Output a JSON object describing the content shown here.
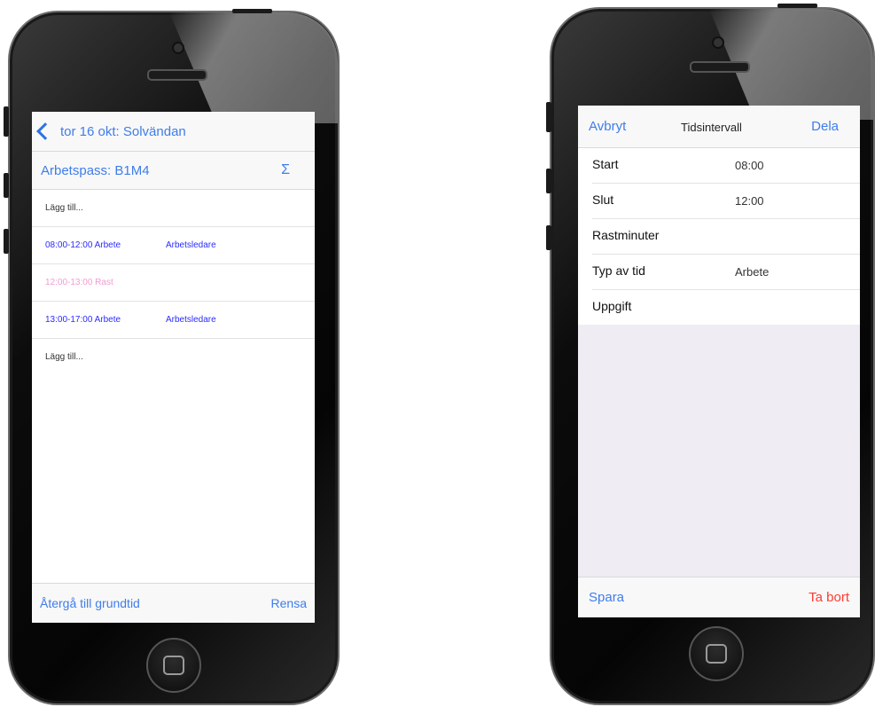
{
  "left": {
    "back_label": "tor 16 okt: Solvändan",
    "subheader_title": "Arbetspass: B1M4",
    "sum_symbol": "Σ",
    "rows": [
      {
        "time": "Lägg till...",
        "role": "",
        "kind": "add"
      },
      {
        "time": "08:00-12:00 Arbete",
        "role": "Arbetsledare",
        "kind": "work"
      },
      {
        "time": "12:00-13:00 Rast",
        "role": "",
        "kind": "break"
      },
      {
        "time": "13:00-17:00 Arbete",
        "role": "Arbetsledare",
        "kind": "work"
      },
      {
        "time": "Lägg till...",
        "role": "",
        "kind": "add"
      }
    ],
    "toolbar": {
      "revert_label": "Återgå till grundtid",
      "clear_label": "Rensa"
    }
  },
  "right": {
    "cancel_label": "Avbryt",
    "title": "Tidsintervall",
    "share_label": "Dela",
    "fields": [
      {
        "label": "Start",
        "value": "08:00"
      },
      {
        "label": "Slut",
        "value": "12:00"
      },
      {
        "label": "Rastminuter",
        "value": ""
      },
      {
        "label": "Typ av tid",
        "value": "Arbete"
      },
      {
        "label": "Uppgift",
        "value": ""
      }
    ],
    "toolbar": {
      "save_label": "Spara",
      "delete_label": "Ta bort"
    }
  },
  "colors": {
    "accent": "#3f7dea",
    "work_text": "#2b2bff",
    "break_text": "#f39bd0",
    "delete": "#ff3b30"
  },
  "icons": [
    "back-chevron-icon",
    "sigma-icon",
    "camera-icon",
    "speaker-icon",
    "home-button-icon"
  ]
}
